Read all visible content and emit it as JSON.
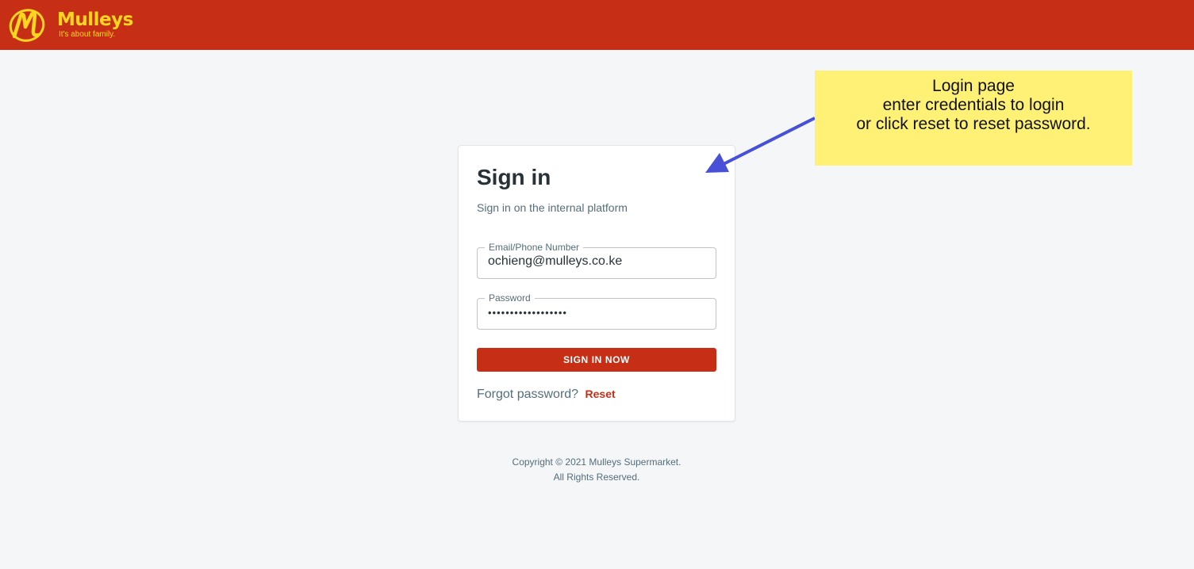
{
  "header": {
    "brand_name": "Mulleys",
    "brand_tagline": "It's about family.",
    "brand_color": "#c62f16",
    "logo_color": "#ffd61f",
    "logo_icon": "mulleys-m-logo"
  },
  "login": {
    "title": "Sign in",
    "subtitle": "Sign in on the internal platform",
    "email_label": "Email/Phone Number",
    "email_value": "ochieng@mulleys.co.ke",
    "password_label": "Password",
    "password_value": "••••••••••••••••••",
    "submit_label": "SIGN IN NOW",
    "forgot_text": "Forgot password?",
    "reset_label": "Reset"
  },
  "footer": {
    "copyright": "Copyright © 2021 Mulleys Supermarket.",
    "rights": "All Rights Reserved."
  },
  "annotation": {
    "line1": "Login page",
    "line2": "enter credentials to login",
    "line3": "or click reset to reset password.",
    "note_color": "#fff176",
    "arrow_color": "#4750d6"
  }
}
